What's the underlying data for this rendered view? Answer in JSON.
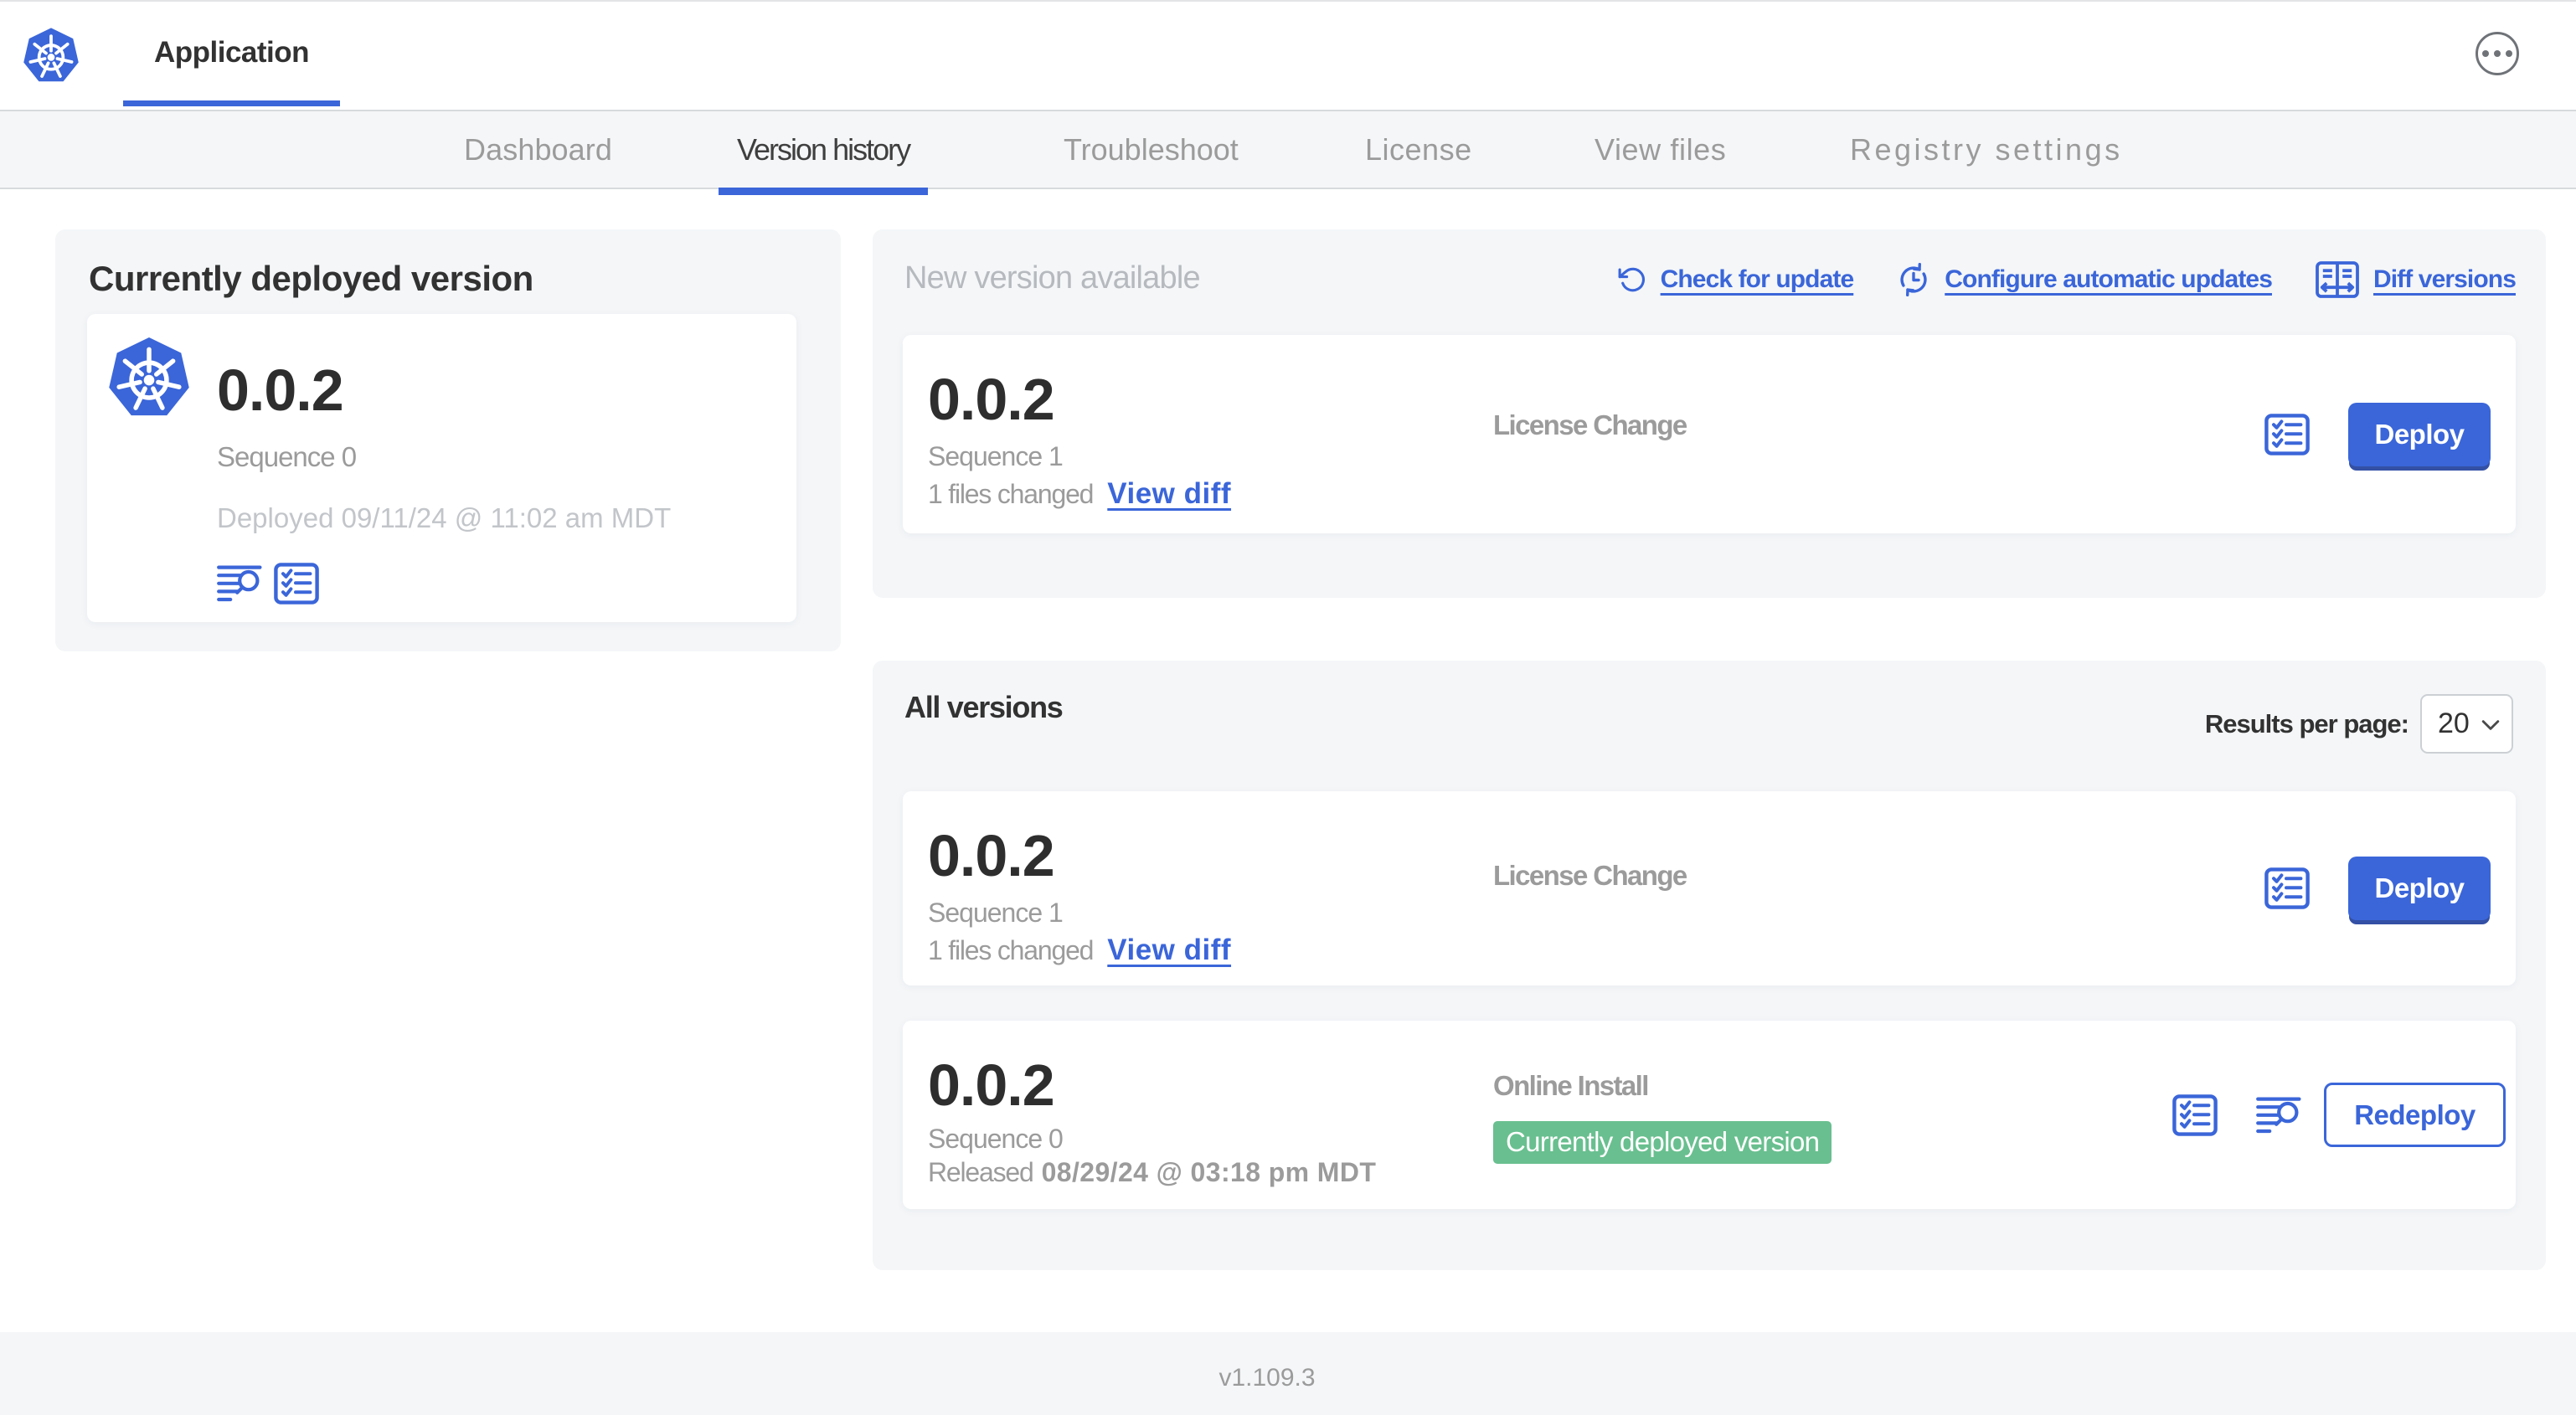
{
  "header": {
    "app_tab": "Application",
    "menu_icon": "ellipsis-menu-icon"
  },
  "nav": {
    "tabs": [
      {
        "label": "Dashboard",
        "active": false
      },
      {
        "label": "Version history",
        "active": true
      },
      {
        "label": "Troubleshoot",
        "active": false
      },
      {
        "label": "License",
        "active": false
      },
      {
        "label": "View files",
        "active": false
      },
      {
        "label": "Registry settings",
        "active": false
      }
    ]
  },
  "deployed": {
    "title": "Currently deployed version",
    "version": "0.0.2",
    "sequence": "Sequence 0",
    "deployed_at": "Deployed 09/11/24 @ 11:02 am MDT",
    "icons": [
      "release-notes-icon",
      "preflight-checklist-icon"
    ]
  },
  "new_version": {
    "title": "New version available",
    "links": [
      {
        "label": "Check for update",
        "icon": "refresh-icon"
      },
      {
        "label": "Configure automatic updates",
        "icon": "schedule-update-icon"
      },
      {
        "label": "Diff versions",
        "icon": "diff-icon"
      }
    ],
    "card": {
      "version": "0.0.2",
      "sequence": "Sequence 1",
      "files_changed": "1 files changed",
      "view_diff": "View diff",
      "source": "License Change",
      "deploy_label": "Deploy"
    }
  },
  "all_versions": {
    "title": "All versions",
    "results_label": "Results per page:",
    "per_page": "20",
    "rows": [
      {
        "version": "0.0.2",
        "sequence": "Sequence 1",
        "files_changed": "1 files changed",
        "view_diff": "View diff",
        "source": "License Change",
        "action": "Deploy"
      },
      {
        "version": "0.0.2",
        "sequence": "Sequence 0",
        "released_prefix": "Released",
        "released_date": "08/29/24 @ 03:18 pm MDT",
        "source": "Online Install",
        "badge": "Currently deployed version",
        "action": "Redeploy"
      }
    ]
  },
  "footer": {
    "version": "v1.109.3"
  },
  "colors": {
    "accent_blue": "#3B66D9",
    "success_green": "#69BF8F",
    "panel_gray": "#F4F6F8",
    "text_dark": "#323232",
    "text_muted": "#9B9B9B"
  }
}
